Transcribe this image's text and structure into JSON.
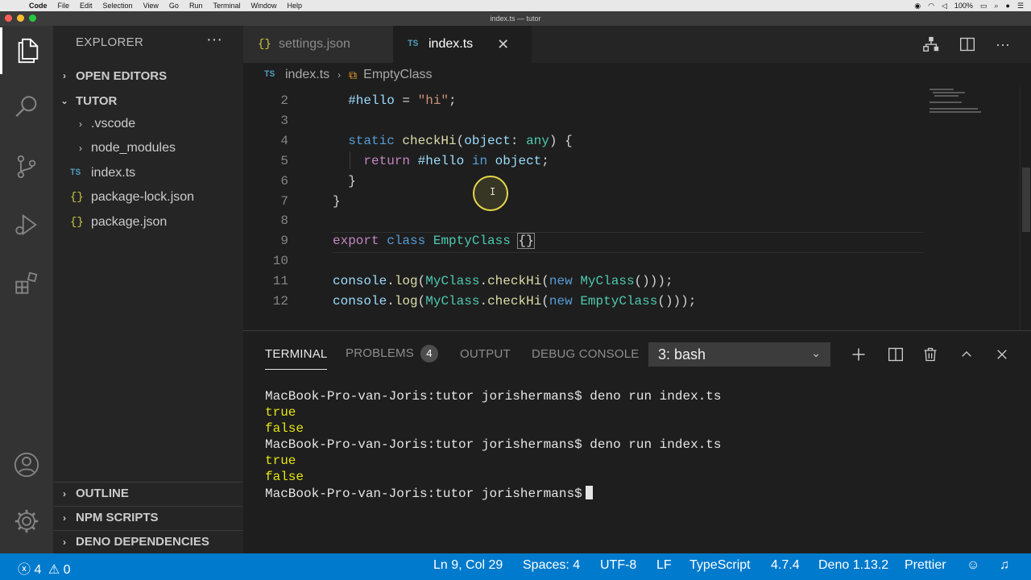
{
  "menubar": {
    "items": [
      "Code",
      "File",
      "Edit",
      "Selection",
      "View",
      "Go",
      "Run",
      "Terminal",
      "Window",
      "Help"
    ],
    "battery": "100%"
  },
  "window": {
    "title": "index.ts — tutor"
  },
  "sidebar": {
    "title": "EXPLORER",
    "more_label": "···",
    "open_editors": "OPEN EDITORS",
    "folder": "TUTOR",
    "tree": [
      {
        "label": ".vscode",
        "kind": "folder"
      },
      {
        "label": "node_modules",
        "kind": "folder"
      },
      {
        "label": "index.ts",
        "kind": "ts"
      },
      {
        "label": "package-lock.json",
        "kind": "json"
      },
      {
        "label": "package.json",
        "kind": "json"
      }
    ],
    "outline": "OUTLINE",
    "npm_scripts": "NPM SCRIPTS",
    "deno_deps": "DENO DEPENDENCIES"
  },
  "icons": {
    "ts": "TS",
    "json": "{}"
  },
  "tabs": {
    "inactive": "settings.json",
    "active": "index.ts",
    "close": "✕",
    "more": "···"
  },
  "breadcrumb": {
    "file": "index.ts",
    "symbol": "EmptyClass"
  },
  "editor": {
    "line_numbers": [
      "2",
      "3",
      "4",
      "5",
      "6",
      "7",
      "8",
      "9",
      "10",
      "11",
      "12"
    ]
  },
  "panel": {
    "tabs": [
      "TERMINAL",
      "PROBLEMS",
      "OUTPUT",
      "DEBUG CONSOLE"
    ],
    "problems_count": "4",
    "terminal_select": "3: bash",
    "terminal_lines": [
      "MacBook-Pro-van-Joris:tutor jorishermans$ deno run index.ts",
      "true",
      "false",
      "MacBook-Pro-van-Joris:tutor jorishermans$ deno run index.ts",
      "true",
      "false",
      "MacBook-Pro-van-Joris:tutor jorishermans$"
    ]
  },
  "statusbar": {
    "errors": "4",
    "warnings": "0",
    "position": "Ln 9, Col 29",
    "spaces": "Spaces: 4",
    "encoding": "UTF-8",
    "eol": "LF",
    "language": "TypeScript",
    "ts_version": "4.7.4",
    "deno_version": "Deno 1.13.2",
    "formatter": "Prettier"
  },
  "colors": {
    "statusbar": "#007acc",
    "activitybar": "#333333",
    "sidebar": "#252526",
    "editor": "#1e1e1e"
  }
}
